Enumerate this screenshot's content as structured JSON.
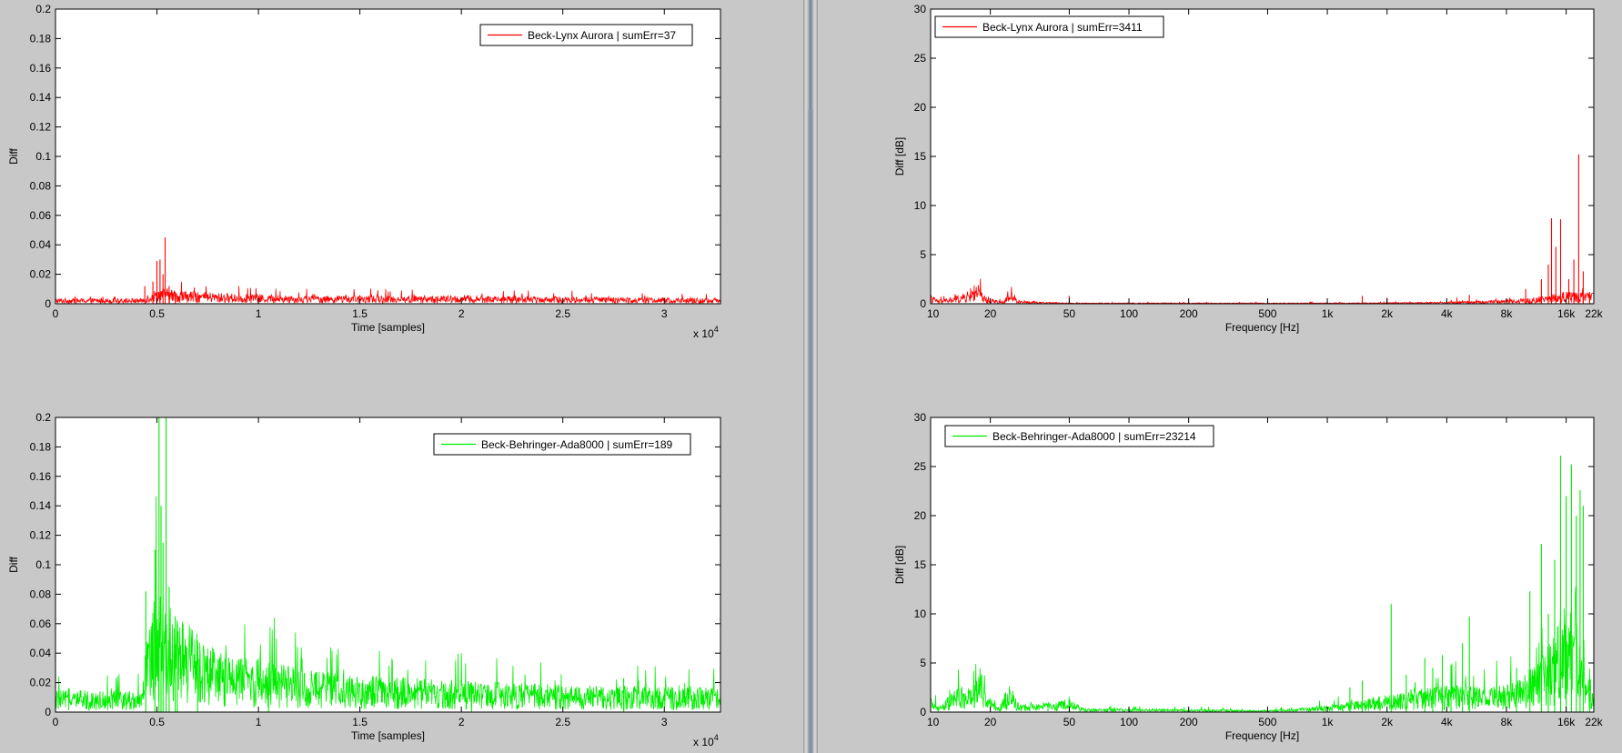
{
  "panels": [
    {
      "id": "p1",
      "color": "#ff0000",
      "legend": "Beck-Lynx Aurora | sumErr=37",
      "xlabel": "Time [samples]",
      "ylabel": "Diff",
      "xmultiplier": "x 10",
      "xmultiplier_exp": "4",
      "yticks": [
        "0",
        "0.02",
        "0.04",
        "0.06",
        "0.08",
        "0.1",
        "0.12",
        "0.14",
        "0.16",
        "0.18",
        "0.2"
      ],
      "xticks": [
        "0",
        "0.5",
        "1",
        "1.5",
        "2",
        "2.5",
        "3"
      ]
    },
    {
      "id": "p2",
      "color": "#ff0000",
      "legend": "Beck-Lynx Aurora | sumErr=3411",
      "xlabel": "Frequency [Hz]",
      "ylabel": "Diff [dB]",
      "yticks": [
        "0",
        "5",
        "10",
        "15",
        "20",
        "25",
        "30"
      ],
      "xticks": [
        "10",
        "20",
        "50",
        "100",
        "200",
        "500",
        "1k",
        "2k",
        "4k",
        "8k",
        "16k",
        "22k"
      ]
    },
    {
      "id": "p3",
      "color": "#00ee00",
      "legend": "Beck-Behringer-Ada8000 | sumErr=189",
      "xlabel": "Time [samples]",
      "ylabel": "Diff",
      "xmultiplier": "x 10",
      "xmultiplier_exp": "4",
      "yticks": [
        "0",
        "0.02",
        "0.04",
        "0.06",
        "0.08",
        "0.1",
        "0.12",
        "0.14",
        "0.16",
        "0.18",
        "0.2"
      ],
      "xticks": [
        "0",
        "0.5",
        "1",
        "1.5",
        "2",
        "2.5",
        "3"
      ]
    },
    {
      "id": "p4",
      "color": "#00ee00",
      "legend": "Beck-Behringer-Ada8000 | sumErr=23214",
      "xlabel": "Frequency [Hz]",
      "ylabel": "Diff [dB]",
      "yticks": [
        "0",
        "5",
        "10",
        "15",
        "20",
        "25",
        "30"
      ],
      "xticks": [
        "10",
        "20",
        "50",
        "100",
        "200",
        "500",
        "1k",
        "2k",
        "4k",
        "8k",
        "16k",
        "22k"
      ]
    }
  ],
  "chart_data": [
    {
      "type": "line",
      "legend": "Beck-Lynx Aurora | sumErr=37",
      "xlabel": "Time [samples]",
      "ylabel": "Diff",
      "xlim": [
        0,
        32768
      ],
      "ylim": [
        0,
        0.2
      ],
      "xscale": "linear",
      "grid": false,
      "legend_position": "top-right",
      "series": [
        {
          "name": "Beck-Lynx Aurora | sumErr=37",
          "color": "#ff0000",
          "noise_floor": [
            [
              0,
              0.002
            ],
            [
              4300,
              0.002
            ],
            [
              4600,
              0.004
            ],
            [
              5200,
              0.006
            ],
            [
              6000,
              0.005
            ],
            [
              8000,
              0.004
            ],
            [
              12000,
              0.003
            ],
            [
              20000,
              0.003
            ],
            [
              32768,
              0.002
            ]
          ],
          "peaks": [
            [
              4400,
              0.012
            ],
            [
              4800,
              0.015
            ],
            [
              5000,
              0.029
            ],
            [
              5150,
              0.03
            ],
            [
              5300,
              0.02
            ],
            [
              5400,
              0.045
            ],
            [
              5600,
              0.012
            ],
            [
              5900,
              0.008
            ]
          ]
        }
      ]
    },
    {
      "type": "line",
      "legend": "Beck-Lynx Aurora | sumErr=3411",
      "xlabel": "Frequency [Hz]",
      "ylabel": "Diff [dB]",
      "xlim": [
        10,
        22050
      ],
      "ylim": [
        0,
        30
      ],
      "xscale": "log",
      "grid": false,
      "legend_position": "top-left",
      "series": [
        {
          "name": "Beck-Lynx Aurora | sumErr=3411",
          "color": "#ff0000",
          "noise_floor": [
            [
              10,
              0.5
            ],
            [
              11,
              0.2
            ],
            [
              13,
              0.4
            ],
            [
              15,
              0.6
            ],
            [
              17,
              1.2
            ],
            [
              19,
              0.4
            ],
            [
              23,
              0.1
            ],
            [
              25,
              0.6
            ],
            [
              28,
              0.2
            ],
            [
              35,
              0.1
            ],
            [
              50,
              0.05
            ],
            [
              100,
              0.05
            ],
            [
              1000,
              0.05
            ],
            [
              4000,
              0.1
            ],
            [
              10000,
              0.3
            ],
            [
              16000,
              0.7
            ],
            [
              22050,
              0.6
            ]
          ],
          "peaks": [
            [
              50,
              0.8
            ],
            [
              1500,
              0.8
            ],
            [
              2000,
              0.6
            ],
            [
              4500,
              0.6
            ],
            [
              5200,
              0.9
            ],
            [
              10000,
              1.5
            ],
            [
              12000,
              2.5
            ],
            [
              13000,
              4
            ],
            [
              13500,
              8.7
            ],
            [
              14200,
              5.8
            ],
            [
              15000,
              8.6
            ],
            [
              16500,
              2.5
            ],
            [
              17500,
              4.5
            ],
            [
              18500,
              15.2
            ],
            [
              19500,
              3.3
            ],
            [
              21000,
              1.2
            ]
          ]
        }
      ]
    },
    {
      "type": "line",
      "legend": "Beck-Behringer-Ada8000 | sumErr=189",
      "xlabel": "Time [samples]",
      "ylabel": "Diff",
      "xlim": [
        0,
        32768
      ],
      "ylim": [
        0,
        0.2
      ],
      "xscale": "linear",
      "grid": false,
      "legend_position": "top-right",
      "series": [
        {
          "name": "Beck-Behringer-Ada8000 | sumErr=189",
          "color": "#00ee00",
          "noise_floor": [
            [
              0,
              0.008
            ],
            [
              4300,
              0.008
            ],
            [
              4450,
              0.03
            ],
            [
              5000,
              0.045
            ],
            [
              5600,
              0.04
            ],
            [
              6000,
              0.035
            ],
            [
              7000,
              0.03
            ],
            [
              8000,
              0.022
            ],
            [
              10000,
              0.02
            ],
            [
              12000,
              0.016
            ],
            [
              16000,
              0.013
            ],
            [
              20000,
              0.012
            ],
            [
              25000,
              0.01
            ],
            [
              32768,
              0.009
            ]
          ],
          "peaks": [
            [
              4450,
              0.082
            ],
            [
              4900,
              0.11
            ],
            [
              5100,
              0.2
            ],
            [
              5200,
              0.14
            ],
            [
              5300,
              0.115
            ],
            [
              5450,
              0.2
            ],
            [
              5600,
              0.085
            ],
            [
              5900,
              0.065
            ],
            [
              6000,
              0.06
            ],
            [
              7000,
              0.04
            ],
            [
              10500,
              0.03
            ],
            [
              20500,
              0.02
            ],
            [
              28000,
              0.023
            ]
          ]
        }
      ]
    },
    {
      "type": "line",
      "legend": "Beck-Behringer-Ada8000 | sumErr=23214",
      "xlabel": "Frequency [Hz]",
      "ylabel": "Diff [dB]",
      "xlim": [
        10,
        22050
      ],
      "ylim": [
        0,
        30
      ],
      "xscale": "log",
      "grid": false,
      "legend_position": "top-left",
      "series": [
        {
          "name": "Beck-Behringer-Ada8000 | sumErr=23214",
          "color": "#00ee00",
          "noise_floor": [
            [
              10,
              0.8
            ],
            [
              11,
              0.3
            ],
            [
              13,
              1.2
            ],
            [
              15,
              1.6
            ],
            [
              16,
              1.2
            ],
            [
              17,
              3.5
            ],
            [
              19,
              1.0
            ],
            [
              22,
              0.3
            ],
            [
              25,
              1.6
            ],
            [
              28,
              0.4
            ],
            [
              35,
              0.5
            ],
            [
              50,
              0.7
            ],
            [
              60,
              0.2
            ],
            [
              500,
              0.1
            ],
            [
              1000,
              0.4
            ],
            [
              2000,
              1.0
            ],
            [
              4000,
              1.5
            ],
            [
              8000,
              1.5
            ],
            [
              12000,
              3
            ],
            [
              16000,
              6
            ],
            [
              20000,
              4
            ],
            [
              22050,
              1
            ]
          ],
          "peaks": [
            [
              50,
              1.2
            ],
            [
              1300,
              2.5
            ],
            [
              1500,
              3.2
            ],
            [
              2100,
              11
            ],
            [
              2500,
              3.8
            ],
            [
              3100,
              5.5
            ],
            [
              3400,
              4.5
            ],
            [
              3800,
              5.8
            ],
            [
              4200,
              4.8
            ],
            [
              4800,
              7
            ],
            [
              5200,
              9.7
            ],
            [
              9000,
              4.5
            ],
            [
              10500,
              12.3
            ],
            [
              12000,
              17.1
            ],
            [
              13000,
              10
            ],
            [
              14000,
              15.5
            ],
            [
              15000,
              26.1
            ],
            [
              16000,
              22
            ],
            [
              17000,
              25.2
            ],
            [
              18000,
              20
            ],
            [
              18800,
              22.6
            ],
            [
              19500,
              21
            ],
            [
              21000,
              2
            ]
          ]
        }
      ]
    }
  ]
}
